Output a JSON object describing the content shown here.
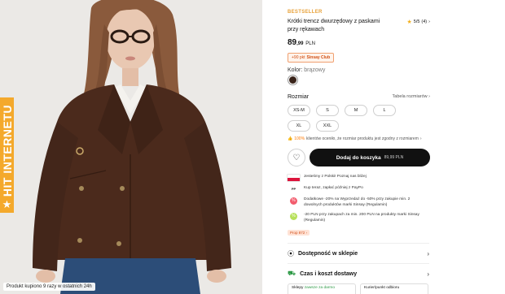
{
  "product": {
    "badge": "BESTSELLER",
    "title": "Krótki trencz dwurzędowy z paskami przy rękawach",
    "rating": {
      "score": "5/5",
      "count": "(4)"
    },
    "price": {
      "main": "89",
      "decimals": ",99",
      "currency": "PLN"
    },
    "club_offer": {
      "value": "+90 pkt",
      "label": "Sinsay Club"
    },
    "color": {
      "label": "Kolor:",
      "value": "brązowy",
      "hex": "#3a241a"
    },
    "size": {
      "label": "Rozmiar",
      "guide": "Tabela rozmiarów",
      "options": [
        "XS-M",
        "S",
        "M",
        "L",
        "XL",
        "XXL"
      ]
    },
    "fit_note": {
      "pct": "100%",
      "text": "klientów oceniło, że rozmiar produktu jest zgodny z rozmiarem"
    },
    "add_to_cart": {
      "label": "Dodaj do koszyka",
      "price": "89,99 PLN"
    }
  },
  "photo": {
    "hit_badge": "HIT INTERNETU",
    "bought_note": "Produkt kupiono 9 razy w ostatnich 24h"
  },
  "perks": [
    {
      "icon": "poland-flag-icon",
      "text": "Jesteśmy z Polski! Poznaj nas bliżej"
    },
    {
      "icon": "paypo-icon",
      "text": "Kup teraz, zapłać później z PayPo"
    },
    {
      "icon": "percent-pink-icon",
      "text": "Dodatkowe -20% na Wyprzedaż do -50% przy zakupie min. 2 dowolnych produktów marki Sinsay (Regulamin)"
    },
    {
      "icon": "percent-green-icon",
      "text": "-20 PLN przy zakupach za min. 200 PLN na produkty marki Sinsay (Regulamin)"
    }
  ],
  "promo_chip": "Prop 872",
  "sections": {
    "availability": "Dostępność w sklepie",
    "delivery": "Czas i koszt dostawy"
  },
  "delivery_cards": [
    {
      "title": "Sklepy",
      "sub": "zawsze za darmo"
    },
    {
      "title": "Kurier/punkt odbioru",
      "sub": ""
    }
  ],
  "colors": {
    "accent": "#f4a92c",
    "primary_button": "#111111"
  }
}
